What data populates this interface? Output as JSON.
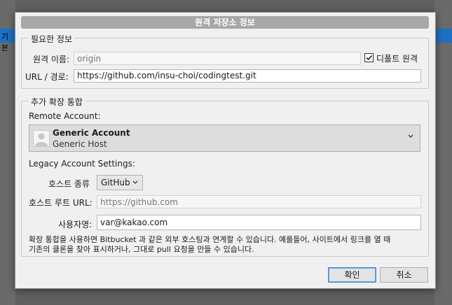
{
  "background": {
    "partial_label": "기본"
  },
  "dialog": {
    "title": "원격 저장소 정보",
    "required_section": {
      "legend": "필요한 정보",
      "remote_name_label": "원격 이름:",
      "remote_name_placeholder": "origin",
      "default_remote_label": "디폴트 원격",
      "default_remote_checked": true,
      "url_label": "URL / 경로:",
      "url_value": "https://github.com/insu-choi/codingtest.git"
    },
    "extended_section": {
      "legend": "추가 확장 통합",
      "remote_account_label": "Remote Account:",
      "account": {
        "name": "Generic Account",
        "host": "Generic Host",
        "icon": "user-avatar-icon"
      },
      "legacy_label": "Legacy Account Settings:",
      "host_type_label": "호스트 종류",
      "host_type_value": "GitHub",
      "host_root_label": "호스트 루트 URL:",
      "host_root_placeholder": "https://github.com",
      "username_label": "사용자명:",
      "username_value": "var@kakao.com",
      "help_line1": "확장 통합을 사용하면 Bitbucket 과 같은 외부 호스팅과 연계할 수 있습니다. 예를들어, 사이트에서 링크를 열 때",
      "help_line2": "기존의 클론을 찾아 표시하거나, 그대로 pull 요청을 만들 수 있습니다."
    },
    "buttons": {
      "ok": "확인",
      "cancel": "취소"
    }
  }
}
